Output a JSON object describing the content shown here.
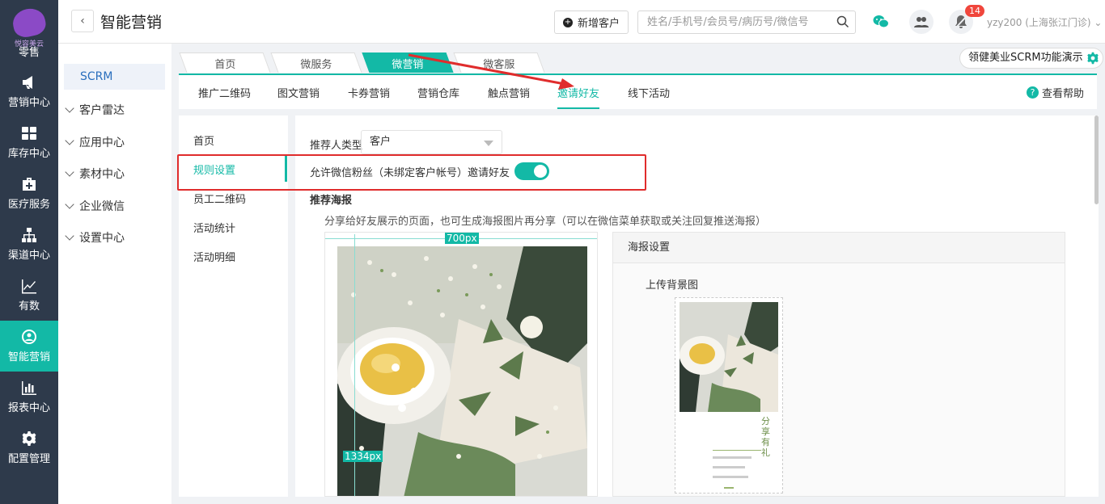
{
  "brand": {
    "logo_text": "悦容美云"
  },
  "leftnav": {
    "items": [
      {
        "label": "零售",
        "icon": "retail-icon"
      },
      {
        "label": "营销中心",
        "icon": "megaphone-icon"
      },
      {
        "label": "库存中心",
        "icon": "grid-icon"
      },
      {
        "label": "医疗服务",
        "icon": "medkit-icon"
      },
      {
        "label": "渠道中心",
        "icon": "hierarchy-icon"
      },
      {
        "label": "有数",
        "icon": "trend-icon"
      },
      {
        "label": "智能营销",
        "icon": "smart-icon",
        "active": true
      },
      {
        "label": "报表中心",
        "icon": "bar-chart-icon"
      },
      {
        "label": "配置管理",
        "icon": "gear-icon"
      }
    ]
  },
  "topbar": {
    "back_label": "‹",
    "title": "智能营销",
    "add_customer": "新增客户",
    "add_icon": "+",
    "search_placeholder": "姓名/手机号/会员号/病历号/微信号",
    "notification_count": "14",
    "user": "yzy200 (上海张江门诊) ⌄"
  },
  "secnav": {
    "active": "SCRM",
    "groups": [
      "客户雷达",
      "应用中心",
      "素材中心",
      "企业微信",
      "设置中心"
    ]
  },
  "tabs": {
    "items": [
      "首页",
      "微服务",
      "微营销",
      "微客服"
    ],
    "active": "微营销",
    "demo_label": "领健美业SCRM功能演示"
  },
  "subtabs": {
    "items": [
      "推广二维码",
      "图文营销",
      "卡券营销",
      "营销仓库",
      "触点营销",
      "邀请好友",
      "线下活动"
    ],
    "active": "邀请好友",
    "help": "查看帮助",
    "help_icon": "?"
  },
  "leftmenu": {
    "items": [
      "首页",
      "规则设置",
      "员工二维码",
      "活动统计",
      "活动明细"
    ],
    "active": "规则设置"
  },
  "form": {
    "referrer_label": "推荐人类型",
    "referrer_value": "客户",
    "allow_label": "允许微信粉丝（未绑定客户帐号）邀请好友",
    "allow_on": true,
    "poster_title": "推荐海报",
    "poster_desc": "分享给好友展示的页面，也可生成海报图片再分享（可以在微信菜单获取或关注回复推送海报）",
    "width_label": "700px",
    "height_label": "1334px",
    "settings_title": "海报设置",
    "upload_label": "上传背景图",
    "thumb_title": "分享有礼"
  },
  "colors": {
    "accent": "#13b9a6",
    "nav_bg": "#2e3a4b",
    "highlight": "#e02c2c"
  }
}
